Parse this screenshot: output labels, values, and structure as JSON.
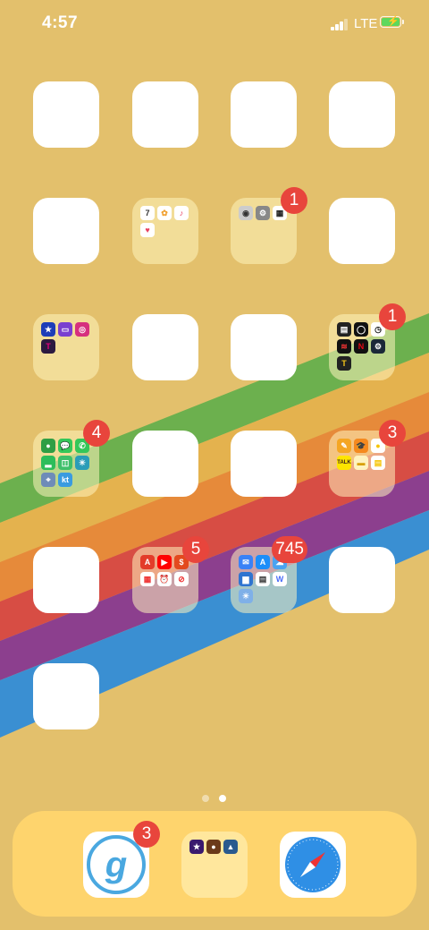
{
  "status_bar": {
    "time": "4:57",
    "network": "LTE",
    "battery_color": "#5dd85d"
  },
  "colors": {
    "wallpaper": "#e3c06c",
    "badge": "#e8453c",
    "dock": "#fed46d"
  },
  "page_dots": {
    "count": 2,
    "active_index": 1
  },
  "folders": {
    "media": {
      "icons": [
        "calendar-icon",
        "photos-icon",
        "music-icon",
        "health-icon"
      ]
    },
    "camera_tools": {
      "badge": "1",
      "icons": [
        "camera-icon",
        "settings-icon",
        "qr-code-icon"
      ]
    },
    "social": {
      "icons": [
        "star-icon",
        "twitch-icon",
        "instagram-icon",
        "tmobile-icon"
      ]
    },
    "entertainment": {
      "badge": "1",
      "icons": [
        "wallet-icon",
        "watch-icon",
        "clock-icon",
        "voice-memo-icon",
        "netflix-icon",
        "steam-icon",
        "font-icon"
      ]
    },
    "communication": {
      "badge": "4",
      "icons": [
        "find-my-icon",
        "messages-icon",
        "phone-icon",
        "line-icon",
        "talk-icon",
        "accessibility-icon",
        "maps-icon"
      ],
      "kt_label": "kt"
    },
    "utilities": {
      "badge": "3",
      "icons": [
        "pencil-icon",
        "graduation-icon",
        "bulb-icon"
      ],
      "talk_label": "TALK"
    },
    "alerts": {
      "badge": "5",
      "icons": [
        "adobe-icon",
        "youtube-icon",
        "money-icon",
        "calendar-alt-icon",
        "alarm-icon",
        "no-sign-icon"
      ]
    },
    "productivity": {
      "badge": "745",
      "icons": [
        "mail-icon",
        "app-store-icon",
        "cloud-icon",
        "files-icon",
        "mail-app-icon",
        "w-icon",
        "weather-icon"
      ]
    }
  },
  "dock": {
    "app1": {
      "letter": "g",
      "badge": "3"
    },
    "games_folder": {
      "icons": [
        "game-1-icon",
        "game-2-icon",
        "game-3-icon"
      ]
    },
    "safari": {
      "name": "safari-icon"
    }
  }
}
